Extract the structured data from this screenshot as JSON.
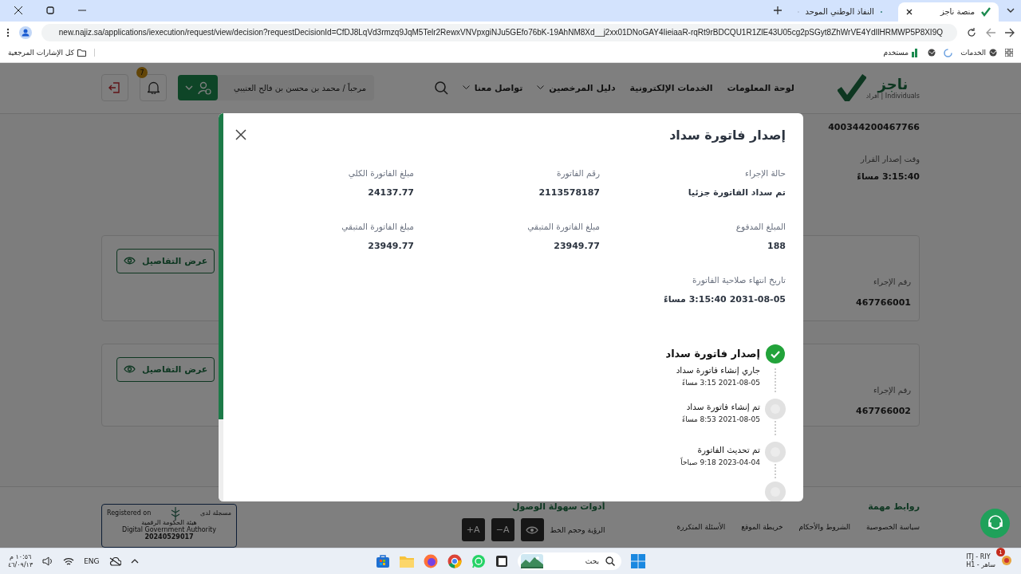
{
  "browser": {
    "tabs": [
      {
        "title": "منصة ناجز",
        "selected": true
      },
      {
        "title": "النفاذ الوطني الموحد",
        "selected": false
      }
    ],
    "url": "new.najiz.sa/applications/iexecution/request/view/decision?requestDecisionId=CfDJ8LqVd3rmzq9JqM5Telr2RewxVNVpxgiNJu5GEfo76bK-19AhNM8Xd__j2xx01DNoGAY4IieiaaR-rqRt9rBDCQU1R1ZlE43U05cg2pSGyt8ZhWrVE4YdIlHRMWP5P8XI9Q",
    "bookmarks": [
      {
        "label": "الخدمات"
      },
      {
        "label": "مستخدم"
      }
    ],
    "all_bookmarks": "كل الإشارات المرجعية"
  },
  "header": {
    "logo": "ناجز",
    "logo_sub": "Individuals | أفراد",
    "nav": [
      {
        "label": "لوحة المعلومات",
        "dropdown": false
      },
      {
        "label": "الخدمات الإلكترونية",
        "dropdown": false
      },
      {
        "label": "دليل المرخصين",
        "dropdown": true
      },
      {
        "label": "تواصل معنا",
        "dropdown": true
      }
    ],
    "greeting": "مرحباً / محمد بن محسن بن فالح العتيبي",
    "notifications": "7"
  },
  "background": {
    "request_number": "400344200467766",
    "decision_time_label": "وقت إصدار القرار",
    "decision_time": "3:15:40 مساءً",
    "cards": [
      {
        "label": "رقم الإجراء",
        "value": "467766001",
        "button": "عرض التفاصيل"
      },
      {
        "label": "رقم الإجراء",
        "value": "467766002",
        "button": "عرض التفاصيل"
      }
    ]
  },
  "footer": {
    "links_title": "روابط مهمة",
    "links": [
      "سياسة الخصوصية",
      "الشروط والأحكام",
      "خريطة الموقع",
      "الأسئلة المتكررة"
    ],
    "accessibility_title": "أدوات سهولة الوصول",
    "vision_label": "الرؤية وحجم الخط",
    "font_buttons": [
      "A−",
      "A+"
    ],
    "registration": {
      "en": "Registered on",
      "ar": "مسجلة لدى",
      "authority_ar": "هيئة الحكومة الرقمية",
      "authority_en": "Digital Government Authority",
      "number": "20240529017"
    }
  },
  "modal": {
    "title": "إصدار فاتورة سداد",
    "fields": [
      {
        "label": "حالة الإجراء",
        "value": "تم سداد الفاتورة جزئيا"
      },
      {
        "label": "رقم الفاتورة",
        "value": "2113578187"
      },
      {
        "label": "مبلغ الفاتورة الكلي",
        "value": "24137.77"
      },
      {
        "label": "المبلغ المدفوع",
        "value": "188"
      },
      {
        "label": "مبلغ الفاتورة المتبقي",
        "value": "23949.77"
      },
      {
        "label": "مبلغ الفاتورة المتبقي",
        "value": "23949.77"
      },
      {
        "label": "تاريخ انتهاء صلاحية الفاتورة",
        "value": "2031-08-05 3:15:40 مساءً"
      }
    ],
    "timeline": [
      {
        "kind": "stage",
        "title": "إصدار فاتورة سداد",
        "done": true
      },
      {
        "kind": "entry",
        "title": "جاري إنشاء فاتورة سداد",
        "date": "2021-08-05 3:15 مساءً"
      },
      {
        "kind": "step",
        "title": "تم إنشاء فاتورة سداد",
        "date": "2021-08-05 8:53 مساءً",
        "done": false
      },
      {
        "kind": "step",
        "title": "تم تحديث الفاتورة",
        "date": "2023-04-04 9:18 صباحاً",
        "done": false
      }
    ]
  },
  "taskbar": {
    "time": "١٠:٥٦ م",
    "date": "٤٦/٠٩/١٣",
    "language": "ENG",
    "search_placeholder": "بحث",
    "weather_line1": "ITJ - RIY",
    "weather_line2": "ساهر - H1",
    "alerts": "1"
  }
}
